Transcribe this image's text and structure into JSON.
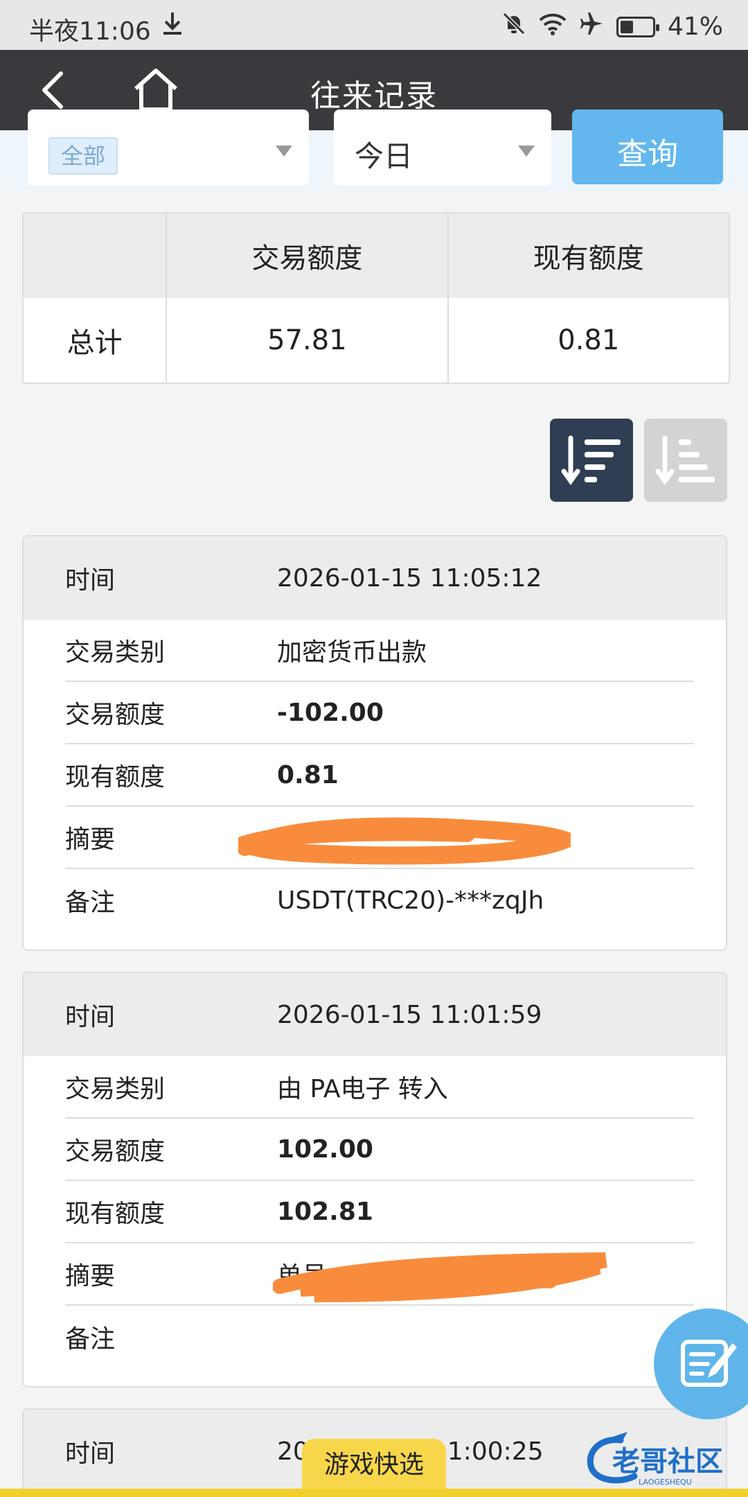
{
  "status_bar": {
    "time": "半夜11:06",
    "battery": "41%",
    "battery_level": 0.41
  },
  "header": {
    "title": "往来记录"
  },
  "filters": {
    "category": "全部",
    "date_range": "今日",
    "query_button": "查询"
  },
  "summary": {
    "col1_header": "",
    "col2_header": "交易额度",
    "col3_header": "现有额度",
    "row_label": "总计",
    "transaction_amount": "57.81",
    "current_amount": "0.81"
  },
  "records": [
    {
      "time_label": "时间",
      "time": "2026-01-15 11:05:12",
      "type_label": "交易类别",
      "type": "加密货币出款",
      "amount_label": "交易额度",
      "amount": "-102.00",
      "balance_label": "现有额度",
      "balance": "0.81",
      "summary_label": "摘要",
      "summary": "",
      "note_label": "备注",
      "note": "USDT(TRC20)-***zqJh"
    },
    {
      "time_label": "时间",
      "time": "2026-01-15 11:01:59",
      "type_label": "交易类别",
      "type": "由 PA电子 转入",
      "amount_label": "交易额度",
      "amount": "102.00",
      "balance_label": "现有额度",
      "balance": "102.81",
      "summary_label": "摘要",
      "summary": "单号",
      "note_label": "备注",
      "note": ""
    },
    {
      "time_label": "时间",
      "time": "20",
      "time_tail": "1:00:25"
    }
  ],
  "bottom": {
    "quick_select": "游戏快选",
    "watermark": "老哥社区",
    "watermark_sub": "LAOGESHEQU"
  },
  "colors": {
    "title_bar": "#3a3a3e",
    "accent_blue": "#64b7ee",
    "sort_active": "#2f3e52",
    "scribble": "#f98c3c",
    "bottom_yellow": "#f2cf2b"
  }
}
